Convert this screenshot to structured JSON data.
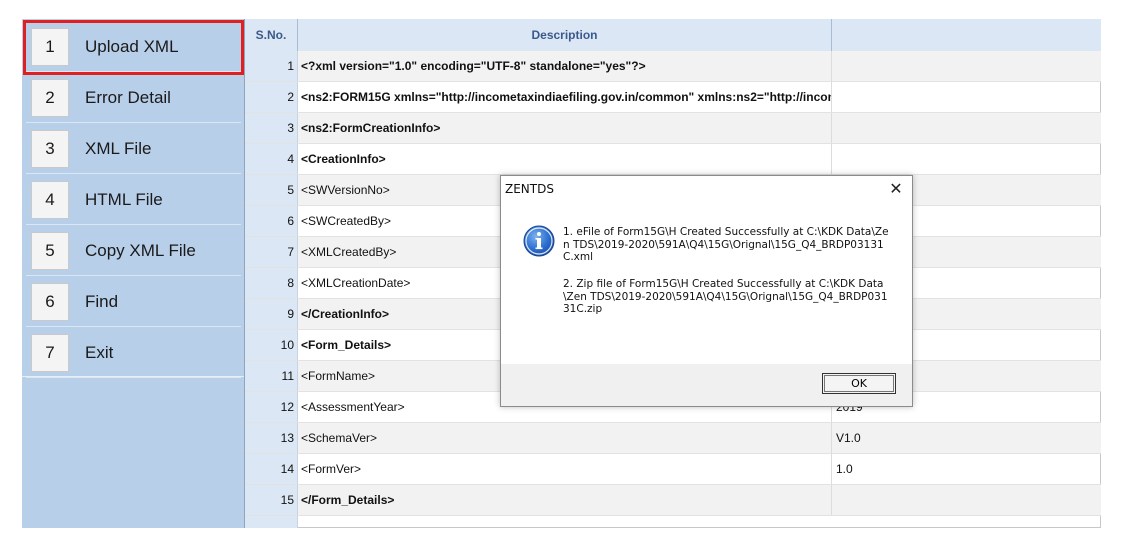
{
  "menu": [
    {
      "num": "1",
      "label": "Upload XML"
    },
    {
      "num": "2",
      "label": "Error Detail"
    },
    {
      "num": "3",
      "label": "XML File"
    },
    {
      "num": "4",
      "label": "HTML File"
    },
    {
      "num": "5",
      "label": "Copy XML File"
    },
    {
      "num": "6",
      "label": "Find"
    },
    {
      "num": "7",
      "label": "Exit"
    }
  ],
  "table": {
    "headers": {
      "sno": "S.No.",
      "description": "Description",
      "value": ""
    },
    "rows": [
      {
        "sno": "1",
        "desc": "<?xml version=\"1.0\" encoding=\"UTF-8\" standalone=\"yes\"?>",
        "val": ""
      },
      {
        "sno": "2",
        "desc": "<ns2:FORM15G xmlns=\"http://incometaxindiaefiling.gov.in/common\" xmlns:ns2=\"http://income",
        "val": ""
      },
      {
        "sno": "3",
        "desc": "<ns2:FormCreationInfo>",
        "val": ""
      },
      {
        "sno": "4",
        "desc": "<CreationInfo>",
        "val": ""
      },
      {
        "sno": "5",
        "desc": "<SWVersionNo>",
        "val": ""
      },
      {
        "sno": "6",
        "desc": "<SWCreatedBy>",
        "val": ""
      },
      {
        "sno": "7",
        "desc": "<XMLCreatedBy>",
        "val": ""
      },
      {
        "sno": "8",
        "desc": "<XMLCreationDate>",
        "val": ""
      },
      {
        "sno": "9",
        "desc": "</CreationInfo>",
        "val": ""
      },
      {
        "sno": "10",
        "desc": "<Form_Details>",
        "val": ""
      },
      {
        "sno": "11",
        "desc": "<FormName>",
        "val": ""
      },
      {
        "sno": "12",
        "desc": "<AssessmentYear>",
        "val": "2019"
      },
      {
        "sno": "13",
        "desc": "<SchemaVer>",
        "val": "V1.0"
      },
      {
        "sno": "14",
        "desc": "<FormVer>",
        "val": "1.0"
      },
      {
        "sno": "15",
        "desc": "</Form_Details>",
        "val": ""
      }
    ]
  },
  "dialog": {
    "title": "ZENTDS",
    "close_glyph": "✕",
    "message1": "1. eFile of Form15G\\H Created Successfully at C:\\KDK Data\\Zen TDS\\2019-2020\\591A\\Q4\\15G\\Orignal\\15G_Q4_BRDP03131C.xml",
    "message2": "2. Zip file of Form15G\\H Created Successfully at C:\\KDK Data\\Zen TDS\\2019-2020\\591A\\Q4\\15G\\Orignal\\15G_Q4_BRDP03131C.zip",
    "ok_label": "OK",
    "icon": "info-icon"
  },
  "colors": {
    "sidebar_bg": "#b8cfe9",
    "header_bg": "#dbe7f5",
    "active_outline": "#e02020"
  }
}
